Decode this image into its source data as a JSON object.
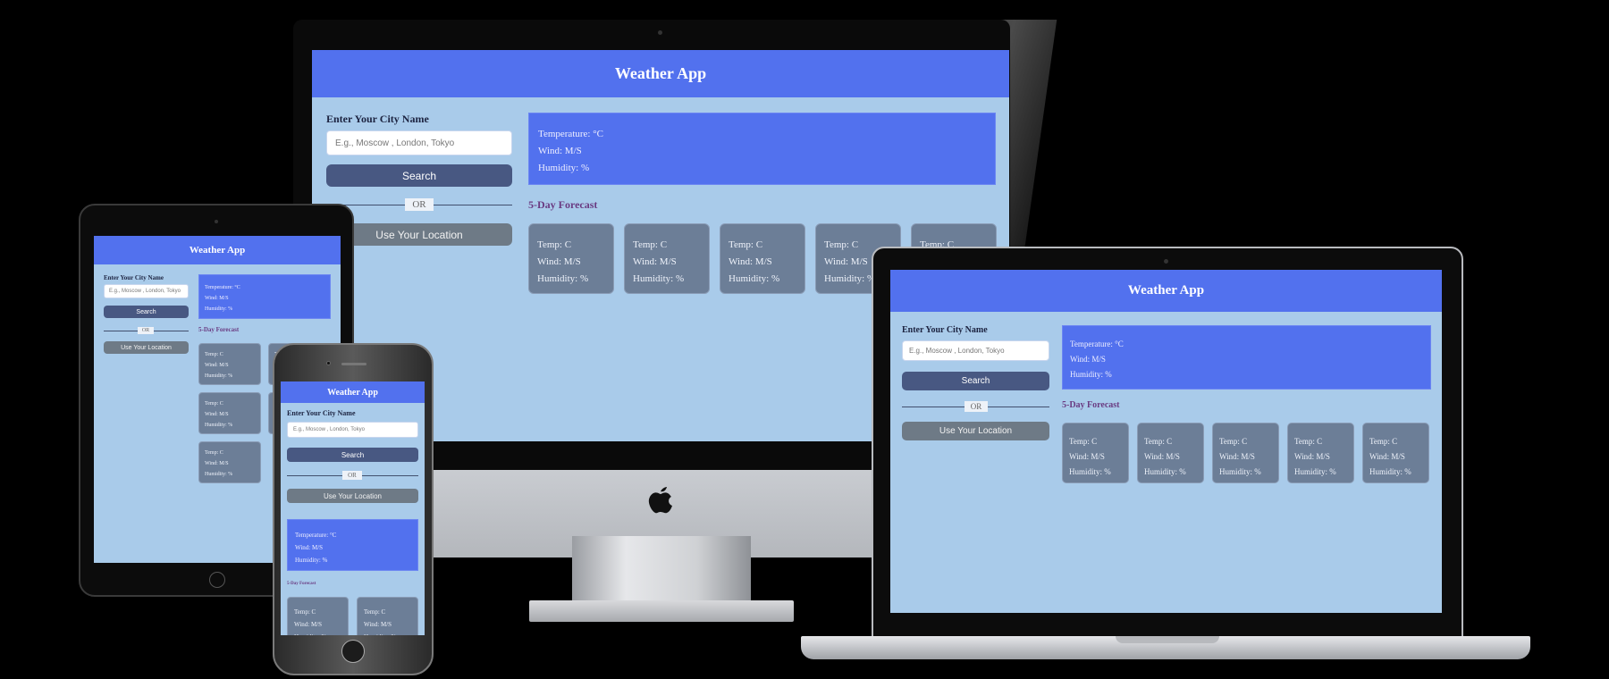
{
  "app": {
    "title": "Weather App",
    "city_label": "Enter Your City Name",
    "city_placeholder": "E.g., Moscow , London, Tokyo",
    "search_button": "Search",
    "or_divider": "OR",
    "location_button": "Use Your Location"
  },
  "current": {
    "temperature": "Temperature: °C",
    "wind": "Wind: M/S",
    "humidity": "Humidity: %"
  },
  "forecast": {
    "heading": "5-Day Forecast",
    "temp": "Temp: C",
    "wind": "Wind: M/S",
    "humidity": "Humidity: %"
  },
  "colors": {
    "header": "#5271ee",
    "background": "#a9cbea",
    "search_button": "#485882",
    "location_button": "#6e7a86",
    "forecast_card": "#6c7e97",
    "forecast_heading": "#6a3b82"
  },
  "devices": [
    "desktop-monitor",
    "tablet",
    "phone",
    "laptop"
  ],
  "icons": {
    "monitor_logo": "apple-logo-icon"
  }
}
